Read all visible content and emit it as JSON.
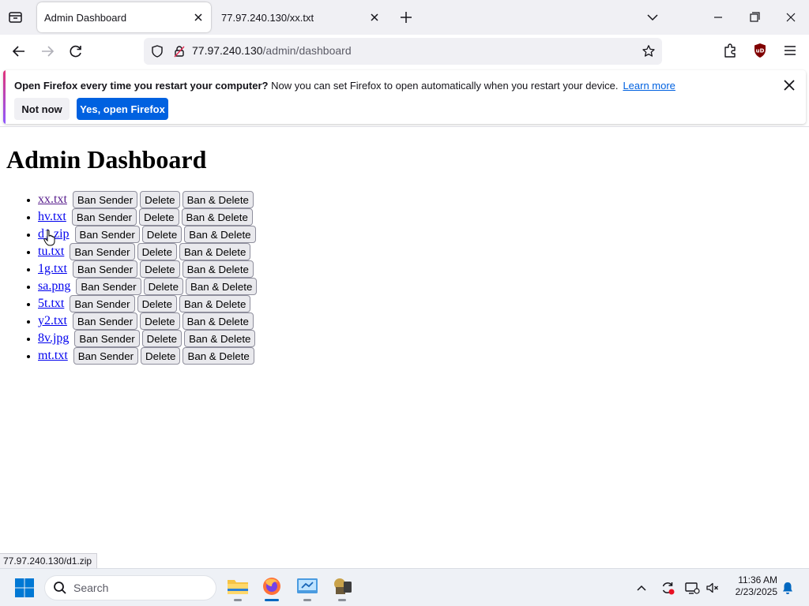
{
  "browser": {
    "tabs": [
      {
        "title": "Admin Dashboard",
        "active": true
      },
      {
        "title": "77.97.240.130/xx.txt",
        "active": false
      }
    ],
    "url": {
      "host": "77.97.240.130",
      "path": "/admin/dashboard"
    },
    "notification": {
      "title": "Open Firefox every time you restart your computer?",
      "message": "Now you can set Firefox to open automatically when you restart your device.",
      "learn_more": "Learn more",
      "not_now": "Not now",
      "confirm": "Yes, open Firefox"
    },
    "status_url": "77.97.240.130/d1.zip"
  },
  "page": {
    "heading": "Admin Dashboard",
    "files": [
      {
        "name": "xx.txt",
        "visited": true
      },
      {
        "name": "hv.txt",
        "visited": false
      },
      {
        "name": "d1.zip",
        "visited": false
      },
      {
        "name": "tu.txt",
        "visited": false
      },
      {
        "name": "1g.txt",
        "visited": false
      },
      {
        "name": "sa.png",
        "visited": false
      },
      {
        "name": "5t.txt",
        "visited": false
      },
      {
        "name": "y2.txt",
        "visited": false
      },
      {
        "name": "8v.jpg",
        "visited": false
      },
      {
        "name": "mt.txt",
        "visited": false
      }
    ],
    "actions": {
      "ban": "Ban Sender",
      "delete": "Delete",
      "ban_delete": "Ban & Delete"
    }
  },
  "taskbar": {
    "search_placeholder": "Search",
    "apps": [
      "file-explorer",
      "firefox",
      "control-panel",
      "app"
    ],
    "active_app": "firefox",
    "time": "11:36 AM",
    "date": "2/23/2025"
  },
  "colors": {
    "accent": "#0061e0",
    "link": "#0000ee",
    "visited": "#551a8b",
    "chrome": "#f0f0f4"
  }
}
